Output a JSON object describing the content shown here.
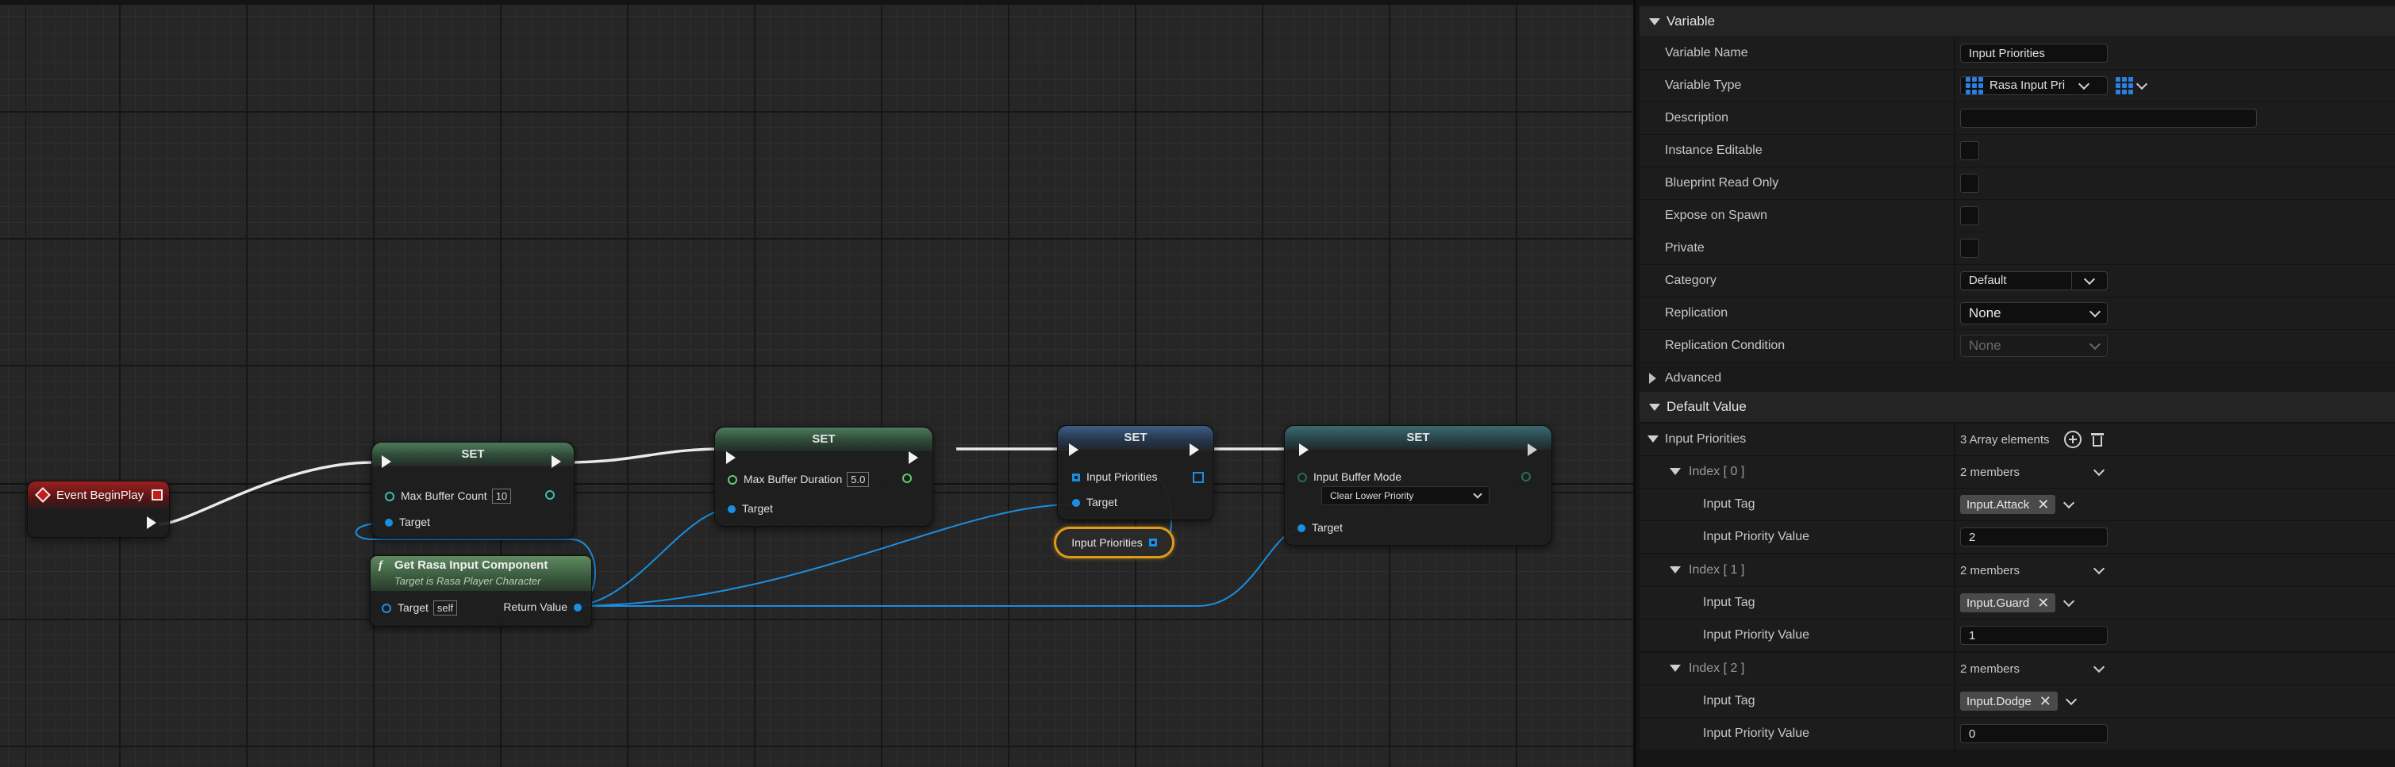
{
  "graph": {
    "event_node": {
      "title": "Event BeginPlay"
    },
    "set1": {
      "title": "SET",
      "pin_label": "Max Buffer Count",
      "pin_value": "10",
      "target_label": "Target"
    },
    "get_component": {
      "title": "Get Rasa Input Component",
      "subtitle": "Target is Rasa Player Character",
      "target_label": "Target",
      "target_value": "self",
      "return_label": "Return Value"
    },
    "set2": {
      "title": "SET",
      "pin_label": "Max Buffer Duration",
      "pin_value": "5.0",
      "target_label": "Target"
    },
    "set3": {
      "title": "SET",
      "pin_label": "Input Priorities",
      "target_label": "Target"
    },
    "var_node": {
      "label": "Input Priorities"
    },
    "set4": {
      "title": "SET",
      "pin_label": "Input Buffer Mode",
      "dropdown_value": "Clear Lower Priority",
      "target_label": "Target"
    }
  },
  "details": {
    "variable_section": "Variable",
    "rows": [
      {
        "label": "Variable Name",
        "value": "Input Priorities"
      },
      {
        "label": "Variable Type",
        "value": "Rasa Input Pri"
      },
      {
        "label": "Description",
        "value": ""
      },
      {
        "label": "Instance Editable"
      },
      {
        "label": "Blueprint Read Only"
      },
      {
        "label": "Expose on Spawn"
      },
      {
        "label": "Private"
      },
      {
        "label": "Category",
        "value": "Default"
      },
      {
        "label": "Replication",
        "value": "None"
      },
      {
        "label": "Replication Condition",
        "value": "None"
      }
    ],
    "advanced": "Advanced",
    "default_value_section": "Default Value",
    "array": {
      "label": "Input Priorities",
      "summary": "3 Array elements"
    },
    "elements": [
      {
        "index_label": "Index [ 0 ]",
        "members": "2 members",
        "tag_label": "Input Tag",
        "tag": "Input.Attack",
        "priority_label": "Input Priority Value",
        "priority": "2"
      },
      {
        "index_label": "Index [ 1 ]",
        "members": "2 members",
        "tag_label": "Input Tag",
        "tag": "Input.Guard",
        "priority_label": "Input Priority Value",
        "priority": "1"
      },
      {
        "index_label": "Index [ 2 ]",
        "members": "2 members",
        "tag_label": "Input Tag",
        "tag": "Input.Dodge",
        "priority_label": "Input Priority Value",
        "priority": "0"
      }
    ]
  },
  "colors": {
    "exec": "#f2f2f2",
    "object_pin": "#1a8fe0",
    "int_pin": "#5ecf6a",
    "selected_outline": "#e09a1a",
    "event_header": "#8a1c1c"
  }
}
